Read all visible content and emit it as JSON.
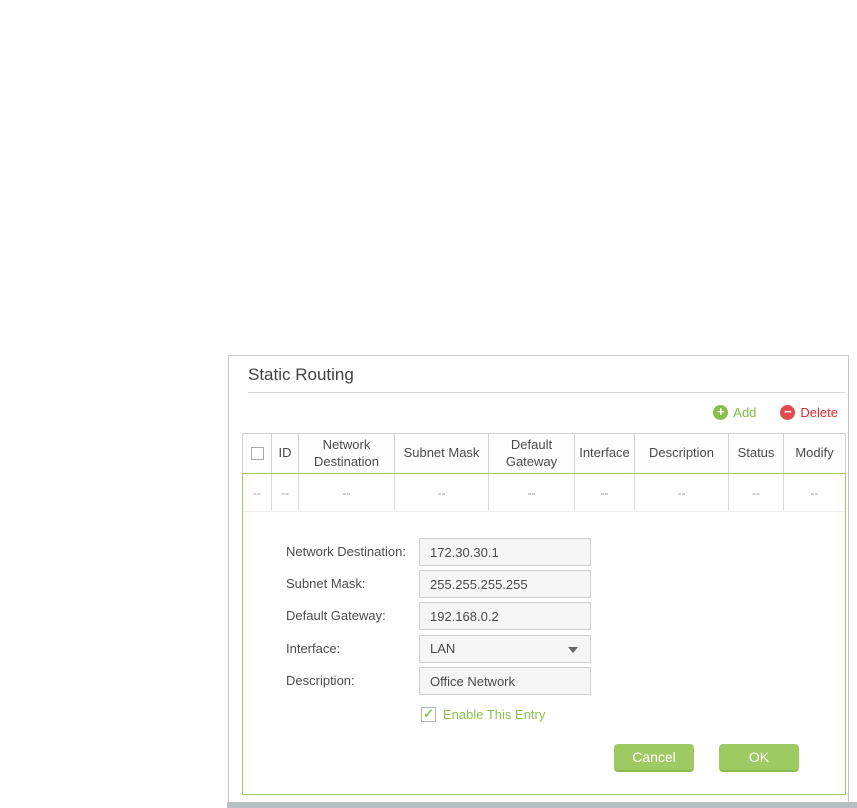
{
  "panel": {
    "title": "Static Routing"
  },
  "toolbar": {
    "add_label": "Add",
    "delete_label": "Delete"
  },
  "table": {
    "columns": [
      "ID",
      "Network Destination",
      "Subnet Mask",
      "Default Gateway",
      "Interface",
      "Description",
      "Status",
      "Modify"
    ],
    "placeholder": "--"
  },
  "form": {
    "fields": [
      {
        "label": "Network Destination:",
        "value": "172.30.30.1"
      },
      {
        "label": "Subnet Mask:",
        "value": "255.255.255.255"
      },
      {
        "label": "Default Gateway:",
        "value": "192.168.0.2"
      },
      {
        "label": "Interface:",
        "value": "LAN"
      },
      {
        "label": "Description:",
        "value": "Office Network"
      }
    ],
    "enable_label": "Enable This Entry",
    "cancel_label": "Cancel",
    "ok_label": "OK"
  },
  "colors": {
    "accent_green": "#8cc152",
    "border_green": "#9ecb60",
    "button_green": "#9dca62",
    "delete_red": "#e14b4b"
  }
}
